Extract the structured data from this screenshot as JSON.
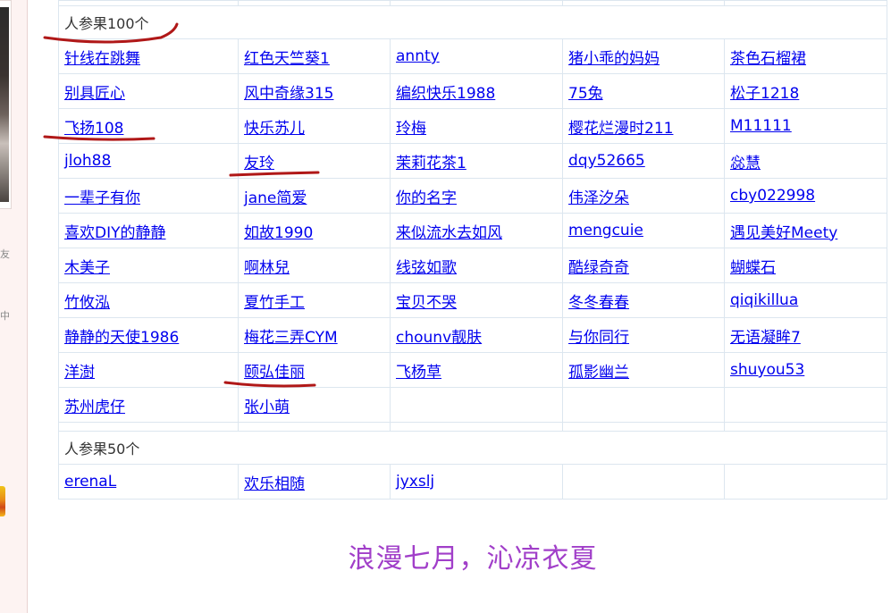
{
  "sidebar": {
    "chars": [
      "友",
      "中"
    ]
  },
  "group100": {
    "heading": "人参果100个",
    "rows": [
      [
        "针线在跳舞",
        "红色天竺葵1",
        "annty",
        "猪小乖的妈妈",
        "茶色石榴裙"
      ],
      [
        "别具匠心",
        "风中奇缘315",
        "编织快乐1988",
        "75兔",
        "松子1218"
      ],
      [
        "飞扬108",
        "快乐苏儿",
        "玲梅",
        "樱花烂漫时211",
        "M11111"
      ],
      [
        "jloh88",
        "友玲",
        "茉莉花茶1",
        "dqy52665",
        "惢慧"
      ],
      [
        "一辈子有你",
        "jane简爱",
        "你的名字",
        "伟泽汐朵",
        "cby022998"
      ],
      [
        "喜欢DIY的静静",
        "如故1990",
        "来似流水去如风",
        "mengcuie",
        "遇见美好Meety"
      ],
      [
        "木美子",
        "啊林兒",
        "线弦如歌",
        "酷绿奇奇",
        "蝴蝶石"
      ],
      [
        "竹攸泓",
        "夏竹手工",
        "宝贝不哭",
        "冬冬春春",
        "qiqikillua"
      ],
      [
        "静静的天使1986",
        "梅花三弄CYM",
        "chounv靓肤",
        "与你同行",
        "无语凝眸7"
      ],
      [
        "洋澍",
        "颐弘佳丽",
        "飞杨草",
        "孤影幽兰",
        "shuyou53"
      ],
      [
        "苏州虎仔",
        "张小萌",
        "",
        "",
        ""
      ]
    ]
  },
  "group50": {
    "heading": "人参果50个",
    "rows": [
      [
        "erenaL",
        "欢乐相随",
        "jyxslj",
        "",
        ""
      ]
    ]
  },
  "footer": {
    "slogan": "浪漫七月，沁凉衣夏"
  },
  "colors": {
    "link": "#0000ee",
    "slogan": "#a13fc9",
    "annotation": "#b01818",
    "border": "#dce6ef"
  }
}
